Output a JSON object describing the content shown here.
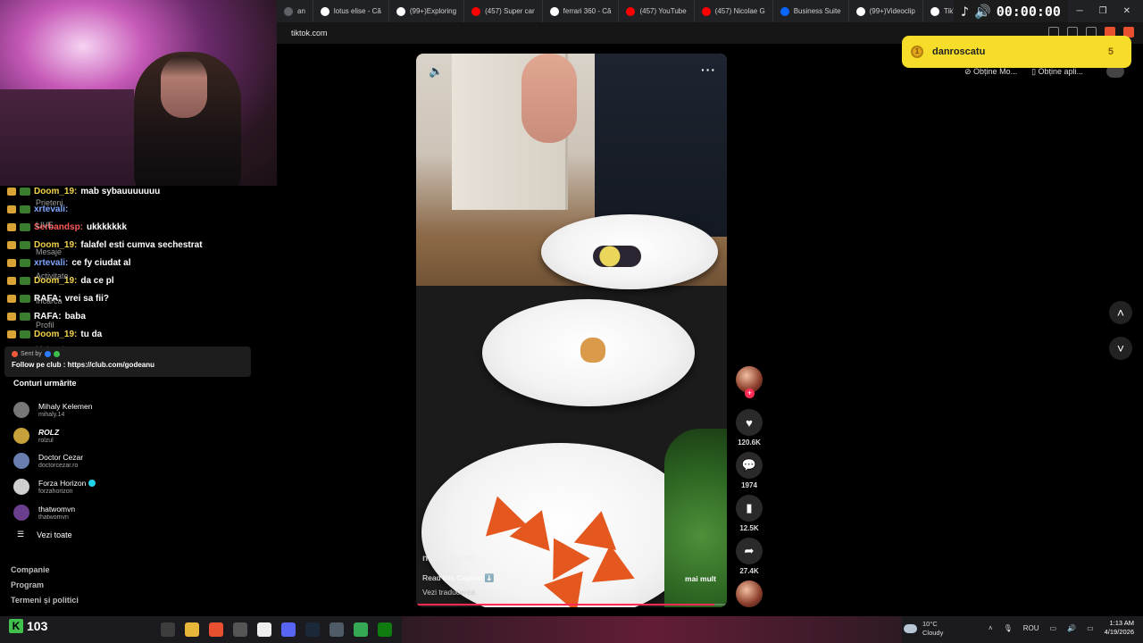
{
  "browser": {
    "tabs": [
      {
        "label": "an",
        "icon": "tab-icon",
        "color": "#5f6368"
      },
      {
        "label": "lotus elise - Că",
        "icon": "google-icon",
        "color": "#ffffff"
      },
      {
        "label": "(99+)Exploring",
        "icon": "tiktok-icon",
        "color": "#ffffff"
      },
      {
        "label": "(457) Super car",
        "icon": "youtube-icon",
        "color": "#ff0000"
      },
      {
        "label": "ferrari 360 - Că",
        "icon": "google-icon",
        "color": "#ffffff"
      },
      {
        "label": "(457) YouTube",
        "icon": "youtube-icon",
        "color": "#ff0000"
      },
      {
        "label": "(457) Nicolae G",
        "icon": "youtube-icon",
        "color": "#ff0000"
      },
      {
        "label": "Business Suite",
        "icon": "meta-icon",
        "color": "#0866ff"
      },
      {
        "label": "(99+)Videoclip",
        "icon": "tiktok-icon",
        "color": "#ffffff"
      },
      {
        "label": "TikTok - Make",
        "icon": "tiktok-icon",
        "color": "#ffffff"
      }
    ],
    "timer": "00:00:00",
    "url": "tiktok.com"
  },
  "chat": {
    "lines": [
      {
        "badge": true,
        "user": "Doom_19:",
        "user_color": "yellow",
        "msg": "mab sybauuuuuuu"
      },
      {
        "badge": true,
        "user": "xrtevali:",
        "user_color": "blue",
        "msg": ""
      },
      {
        "badge": true,
        "user": "Serbandsp:",
        "user_color": "red",
        "msg": "ukkkkkkk"
      },
      {
        "badge": true,
        "user": "Doom_19:",
        "user_color": "yellow",
        "msg": "falafel esti cumva sechestrat"
      },
      {
        "badge": true,
        "user": "xrtevali:",
        "user_color": "blue",
        "msg": "ce fy ciudat al"
      },
      {
        "badge": true,
        "user": "Doom_19:",
        "user_color": "yellow",
        "msg": "da ce pl"
      },
      {
        "badge": true,
        "user": "RAFA:",
        "user_color": "white",
        "msg": "vrei sa fii?"
      },
      {
        "badge": true,
        "user": "RAFA:",
        "user_color": "white",
        "msg": "baba"
      },
      {
        "badge": true,
        "user": "Doom_19:",
        "user_color": "yellow",
        "msg": "tu da"
      }
    ],
    "ghost_items": [
      "Prieteni",
      "LIVE",
      "Mesaje",
      "Activitate",
      "Încărca",
      "Profil",
      "Mai multe"
    ]
  },
  "club": {
    "sent_by": "Sent by",
    "text": "Follow pe club : https://club.com/godeanu"
  },
  "following": {
    "title": "Conturi urmărite",
    "items": [
      {
        "name": "Mihaly Kelemen",
        "handle": "mihaly.14",
        "color": "#777777",
        "verified": false,
        "italic": false
      },
      {
        "name": "ROLZ",
        "handle": "rolzul",
        "color": "#c8a03a",
        "verified": false,
        "italic": true
      },
      {
        "name": "Doctor Cezar",
        "handle": "doctorcezar.ro",
        "color": "#6a7fb0",
        "verified": false,
        "italic": false
      },
      {
        "name": "Forza Horizon",
        "handle": "forzahorizon",
        "color": "#cfcfcf",
        "verified": true,
        "italic": false
      },
      {
        "name": "thatwomvn",
        "handle": "thatwomvn",
        "color": "#6a3f8e",
        "verified": false,
        "italic": false
      }
    ],
    "see_all": "Vezi toate"
  },
  "footer_links": [
    "Companie",
    "Program",
    "Termeni și politici"
  ],
  "video": {
    "author": "nursejahmel",
    "caption": "Read this Caption ⬇️ ...",
    "more": "mai mult",
    "translate": "Vezi traducerea",
    "progress": 0.96
  },
  "actions": {
    "likes": "120.6K",
    "comments": "1974",
    "saves": "12.5K",
    "shares": "27.4K"
  },
  "coins": {
    "name": "danroscatu",
    "count": "5"
  },
  "top_links": [
    "Obține Mo...",
    "Obține apli..."
  ],
  "taskbar": {
    "viewer_count": "103",
    "weather_temp": "10°C",
    "weather_desc": "Cloudy",
    "lang": "ROU",
    "time": "1:13 AM",
    "date": "4/19/2026"
  }
}
